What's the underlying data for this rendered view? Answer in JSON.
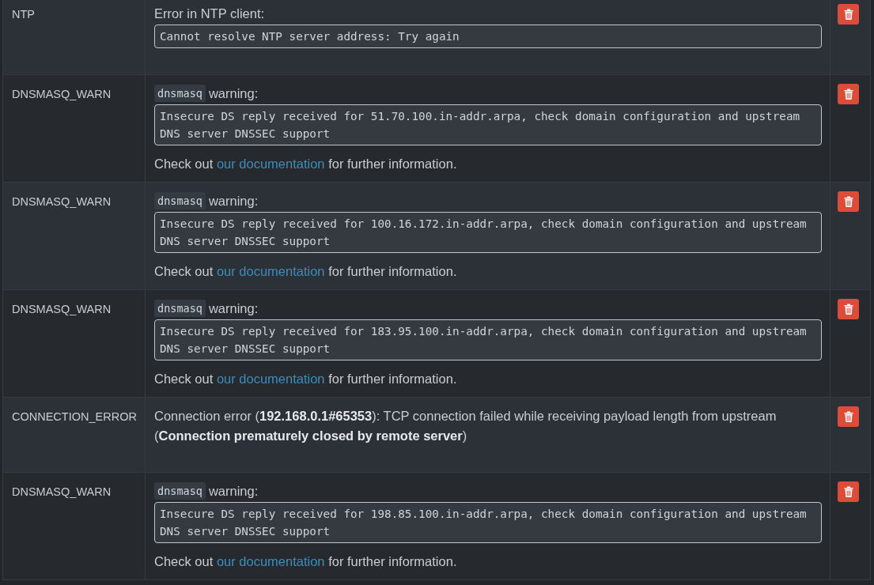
{
  "rows": [
    {
      "type": "NTP",
      "message": {
        "kind": "plain_detail",
        "intro": "Error in NTP client:",
        "detail": "Cannot resolve NTP server address: Try again"
      }
    },
    {
      "type": "DNSMASQ_WARN",
      "message": {
        "kind": "code_warning",
        "code": "dnsmasq",
        "intro": "warning:",
        "detail": "Insecure DS reply received for 51.70.100.in-addr.arpa, check domain configuration and upstream DNS server DNSSEC support",
        "note": {
          "before": "Check out",
          "link": "our documentation",
          "after": "for further information."
        }
      }
    },
    {
      "type": "DNSMASQ_WARN",
      "message": {
        "kind": "code_warning",
        "code": "dnsmasq",
        "intro": "warning:",
        "detail": "Insecure DS reply received for 100.16.172.in-addr.arpa, check domain configuration and upstream DNS server DNSSEC support",
        "note": {
          "before": "Check out",
          "link": "our documentation",
          "after": "for further information."
        }
      }
    },
    {
      "type": "DNSMASQ_WARN",
      "message": {
        "kind": "code_warning",
        "code": "dnsmasq",
        "intro": "warning:",
        "detail": "Insecure DS reply received for 183.95.100.in-addr.arpa, check domain configuration and upstream DNS server DNSSEC support",
        "note": {
          "before": "Check out",
          "link": "our documentation",
          "after": "for further information."
        }
      }
    },
    {
      "type": "CONNECTION_ERROR",
      "message": {
        "kind": "text",
        "text": "Connection error (**192.168.0.1#65353**): TCP connection failed while receiving payload length from upstream (**Connection prematurely closed by remote server**)"
      }
    },
    {
      "type": "DNSMASQ_WARN",
      "message": {
        "kind": "code_warning",
        "code": "dnsmasq",
        "intro": "warning:",
        "detail": "Insecure DS reply received for 198.85.100.in-addr.arpa, check domain configuration and upstream DNS server DNSSEC support",
        "note": {
          "before": "Check out",
          "link": "our documentation",
          "after": "for further information."
        }
      }
    }
  ]
}
